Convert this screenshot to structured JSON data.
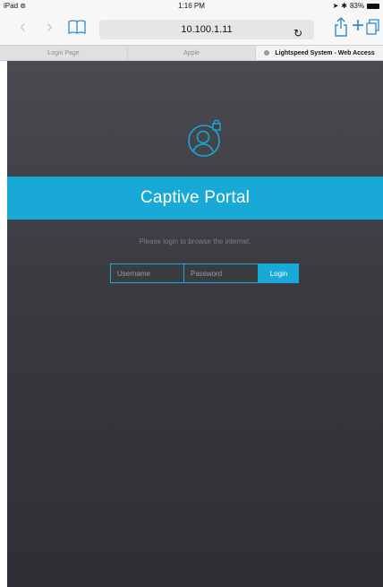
{
  "status_bar": {
    "device": "iPad",
    "time": "1:16 PM",
    "battery": "83%"
  },
  "browser": {
    "url": "10.100.1.11"
  },
  "tabs": [
    {
      "label": "Login Page",
      "active": false
    },
    {
      "label": "Apple",
      "active": false
    },
    {
      "label": "Lightspeed System - Web Access",
      "active": true
    }
  ],
  "page": {
    "title": "Captive Portal",
    "subtitle": "Please login to browse the internet.",
    "username_placeholder": "Username",
    "password_placeholder": "Password",
    "login_label": "Login"
  },
  "colors": {
    "accent": "#19a9d6",
    "background": "#3b3b42"
  }
}
